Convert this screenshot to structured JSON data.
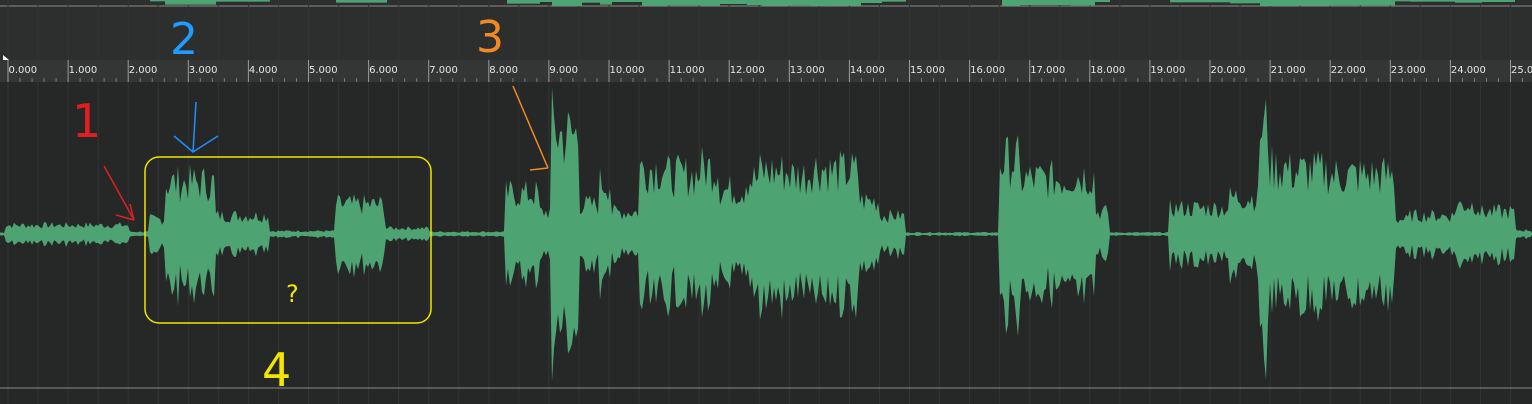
{
  "ruler": {
    "labels": [
      "0.000",
      "1.000",
      "2.000",
      "3.000",
      "4.000",
      "5.000",
      "6.000",
      "7.000",
      "8.000",
      "9.000",
      "10.000",
      "11.000",
      "12.000",
      "13.000",
      "14.000",
      "15.000",
      "16.000",
      "17.000",
      "18.000",
      "19.000",
      "20.000",
      "21.000",
      "22.000",
      "23.000",
      "24.000",
      "25.00"
    ]
  },
  "annotations": {
    "marker_1": "1",
    "marker_2": "2",
    "marker_3": "3",
    "marker_4": "4",
    "question_mark": "?",
    "colors": {
      "red": "#e02020",
      "blue": "#1e90ff",
      "orange": "#f08a24",
      "yellow": "#f2e600"
    }
  },
  "waveform": {
    "color": "#4ea373",
    "centerline_color": "#5c7a66"
  }
}
